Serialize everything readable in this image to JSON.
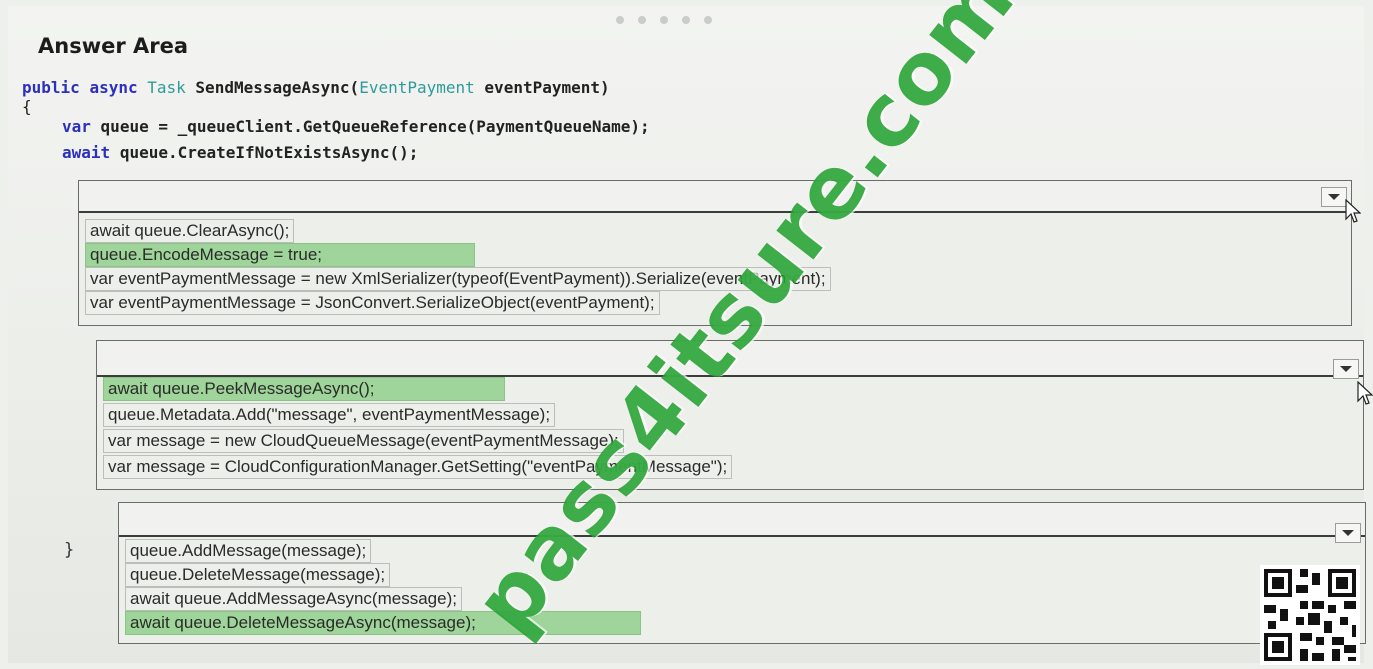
{
  "title": "Answer Area",
  "code": {
    "line1": {
      "kw1": "public",
      "kw2": "async",
      "type1": "Task",
      "method": "SendMessageAsync(",
      "type2": "EventPayment",
      "rest": "eventPayment)"
    },
    "open_brace": "{",
    "line3": {
      "kw": "var",
      "rest": "queue = _queueClient.GetQueueReference(PaymentQueueName);"
    },
    "line4": {
      "kw": "await",
      "rest": "queue.CreateIfNotExistsAsync();"
    },
    "close_brace": "}"
  },
  "dropdowns": [
    {
      "options": [
        {
          "label": "await queue.ClearAsync();",
          "selected": false
        },
        {
          "label": "queue.EncodeMessage = true;",
          "selected": true
        },
        {
          "label": "var eventPaymentMessage = new XmlSerializer(typeof(EventPayment)).Serialize(eventPayment);",
          "selected": false
        },
        {
          "label": "var eventPaymentMessage = JsonConvert.SerializeObject(eventPayment);",
          "selected": false
        }
      ]
    },
    {
      "options": [
        {
          "label": "await queue.PeekMessageAsync();",
          "selected": true
        },
        {
          "label": "queue.Metadata.Add(\"message\", eventPaymentMessage);",
          "selected": false
        },
        {
          "label": "var message = new CloudQueueMessage(eventPaymentMessage);",
          "selected": false
        },
        {
          "label": "var message = CloudConfigurationManager.GetSetting(\"eventPaymentMessage\");",
          "selected": false
        }
      ]
    },
    {
      "options": [
        {
          "label": "queue.AddMessage(message);",
          "selected": false
        },
        {
          "label": "queue.DeleteMessage(message);",
          "selected": false
        },
        {
          "label": "await queue.AddMessageAsync(message);",
          "selected": false
        },
        {
          "label": "await queue.DeleteMessageAsync(message);",
          "selected": true
        }
      ]
    }
  ],
  "icons": {
    "dropdown_arrow": "chevron-down-icon",
    "cursor": "mouse-pointer-icon",
    "qr": "qr-code-icon"
  },
  "watermark": "pass4itsure.com",
  "colors": {
    "selected": "#9fd49a",
    "keyword": "#2d2fbf",
    "type": "#2f9a9a",
    "watermark": "#22a030"
  }
}
